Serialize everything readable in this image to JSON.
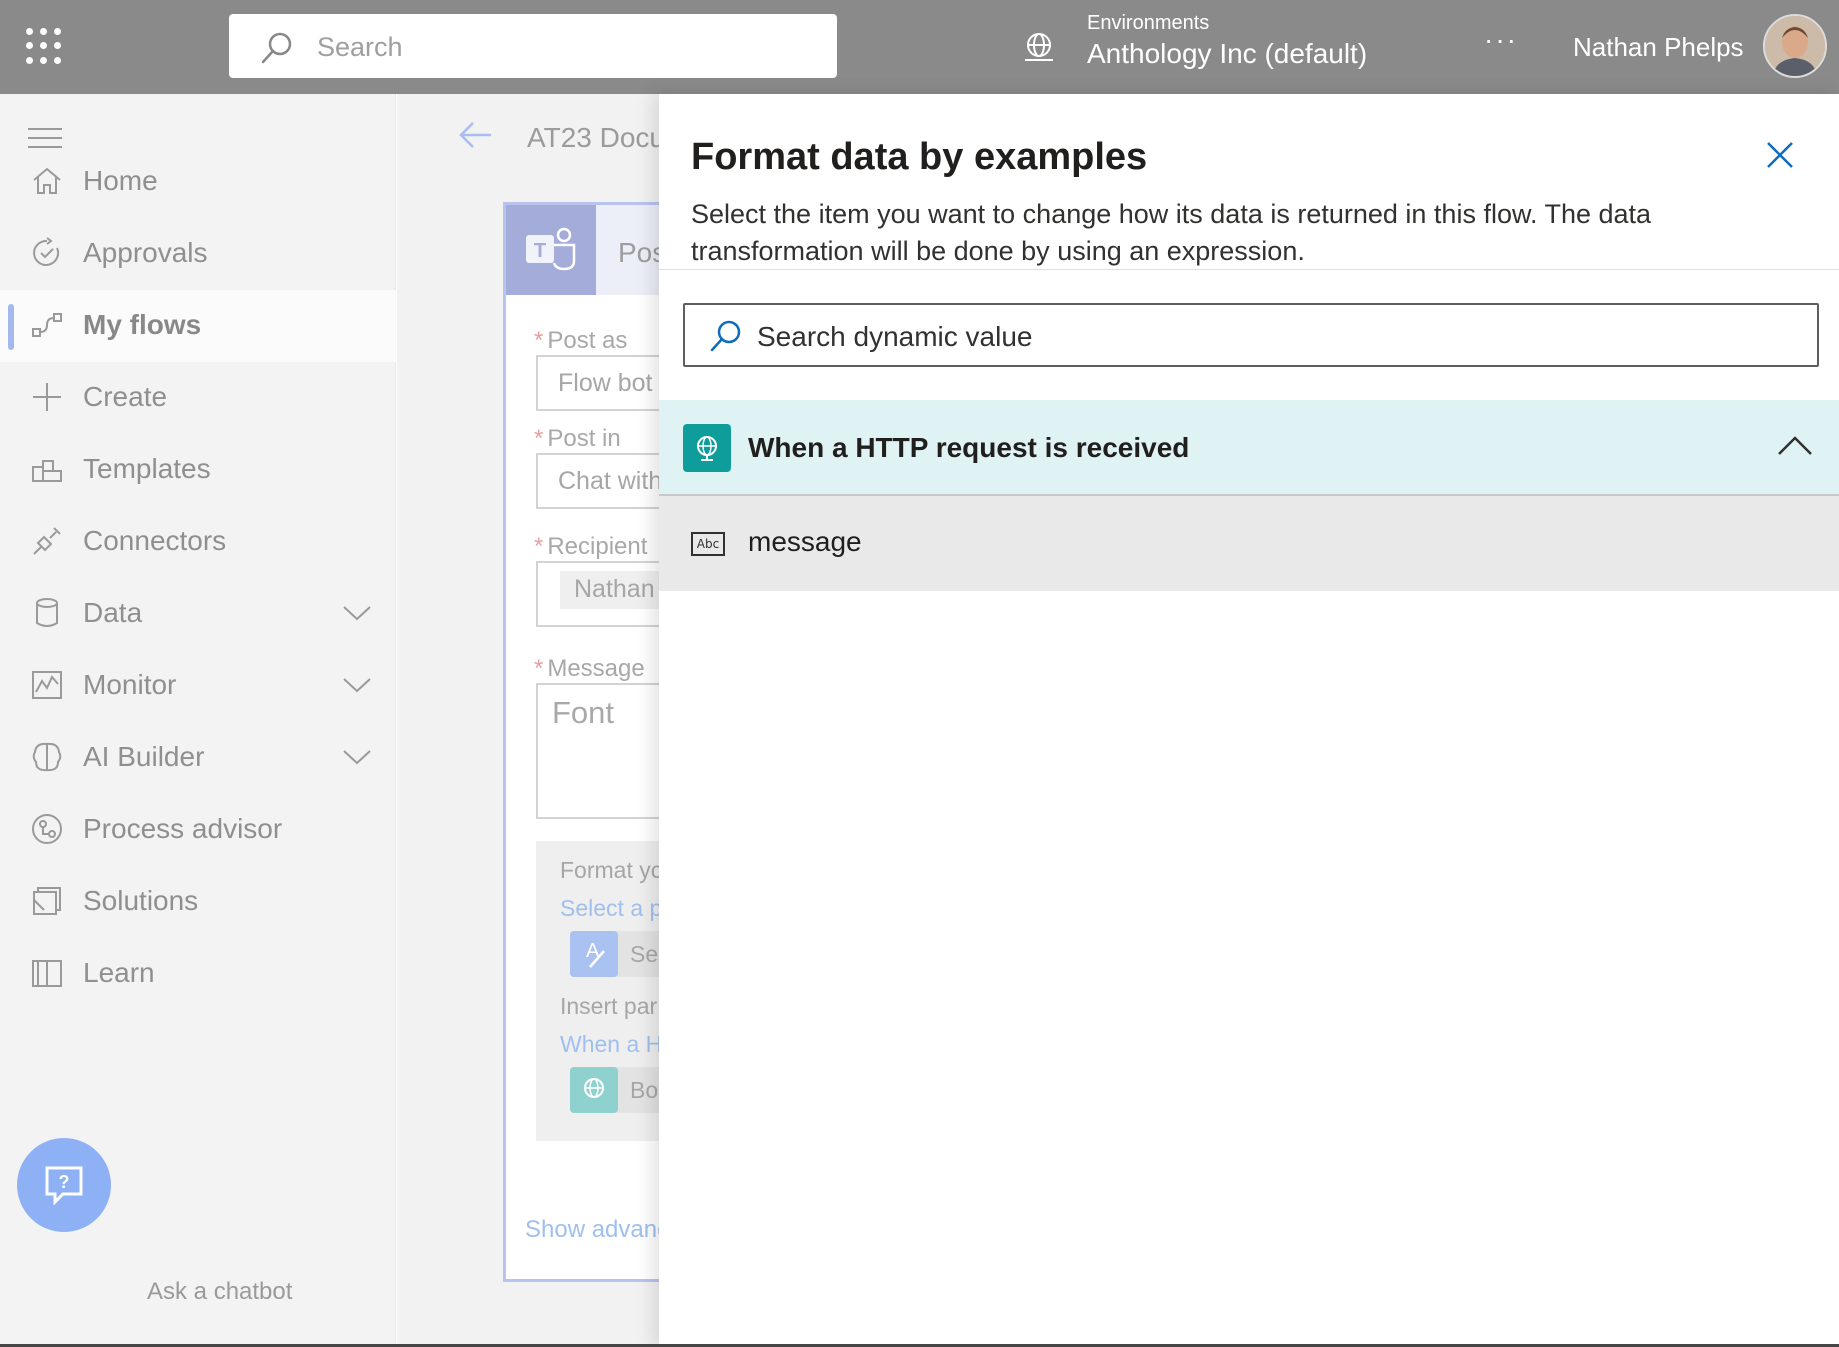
{
  "topbar": {
    "search_placeholder": "Search",
    "environment_label": "Environments",
    "environment_name": "Anthology Inc (default)",
    "more_label": "···",
    "user_name": "Nathan Phelps"
  },
  "leftnav": {
    "items": [
      {
        "label": "Home",
        "icon": "home-icon"
      },
      {
        "label": "Approvals",
        "icon": "approvals-icon"
      },
      {
        "label": "My flows",
        "icon": "flows-icon",
        "selected": true
      },
      {
        "label": "Create",
        "icon": "plus-icon"
      },
      {
        "label": "Templates",
        "icon": "templates-icon"
      },
      {
        "label": "Connectors",
        "icon": "connectors-icon"
      },
      {
        "label": "Data",
        "icon": "database-icon",
        "expandable": true
      },
      {
        "label": "Monitor",
        "icon": "monitor-icon",
        "expandable": true
      },
      {
        "label": "AI Builder",
        "icon": "brain-icon",
        "expandable": true
      },
      {
        "label": "Process advisor",
        "icon": "process-advisor-icon"
      },
      {
        "label": "Solutions",
        "icon": "solutions-icon"
      },
      {
        "label": "Learn",
        "icon": "book-icon"
      }
    ],
    "chatbot_label": "Ask a chatbot"
  },
  "designer": {
    "flow_title": "AT23 Docu",
    "card_title": "Pos",
    "fields": [
      {
        "label": "Post as",
        "value": "Flow bot"
      },
      {
        "label": "Post in",
        "value": "Chat with"
      },
      {
        "label": "Recipient",
        "value": "Nathan"
      },
      {
        "label": "Message",
        "value": "Font"
      }
    ],
    "hint_format": "Format yc",
    "hint_select_link": "Select a p",
    "hint_pill_1": "Se",
    "hint_insert": "Insert par",
    "hint_when_link": "When a H",
    "hint_pill_2": "Bo",
    "show_advanced": "Show advanc"
  },
  "panel": {
    "title": "Format data by examples",
    "description": "Select the item you want to change how its data is returned in this flow. The data transformation will be done by using an expression.",
    "search_placeholder": "Search dynamic value",
    "group_title": "When a HTTP request is received",
    "items": [
      {
        "type_icon": "Abc",
        "label": "message"
      }
    ]
  },
  "colors": {
    "accent": "#0f6cbd",
    "teal": "#0f9d9c",
    "group_bg": "#dff2f4"
  }
}
